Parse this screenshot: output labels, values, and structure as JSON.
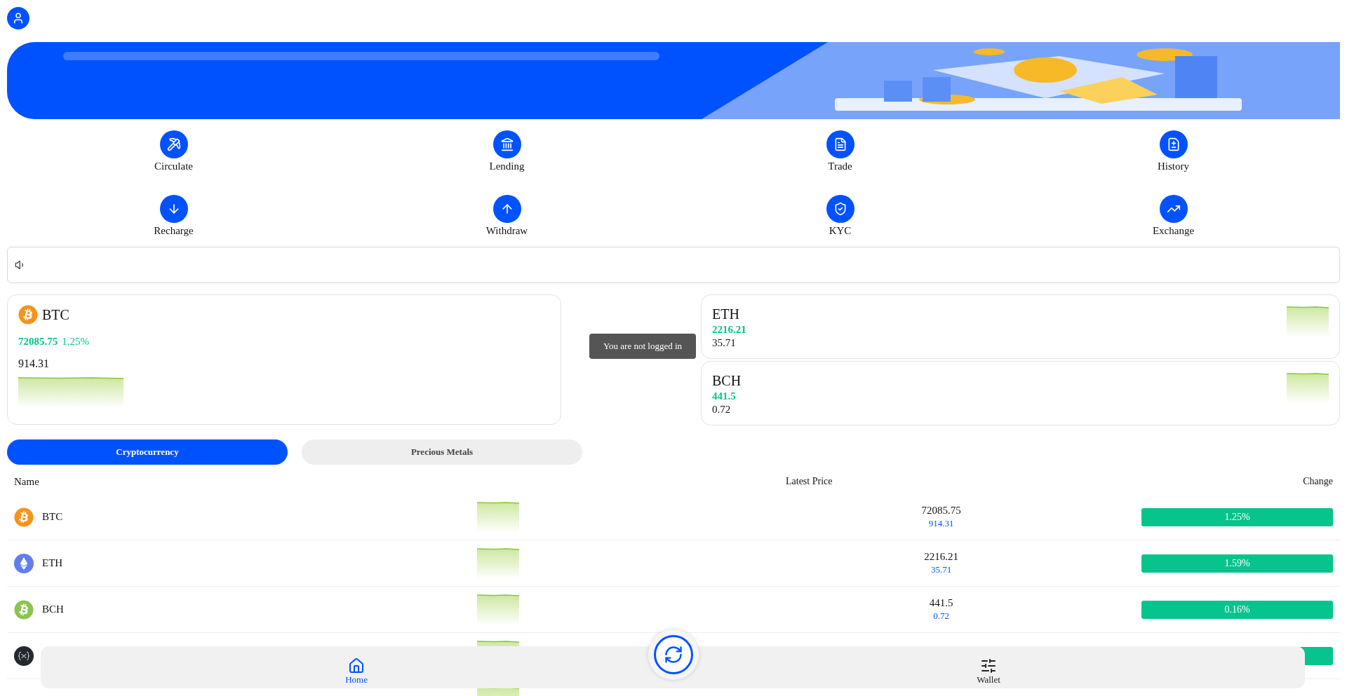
{
  "menu": [
    {
      "label": "Circulate"
    },
    {
      "label": "Lending"
    },
    {
      "label": "Trade"
    },
    {
      "label": "History"
    },
    {
      "label": "Recharge"
    },
    {
      "label": "Withdraw"
    },
    {
      "label": "KYC"
    },
    {
      "label": "Exchange"
    }
  ],
  "featured": {
    "name": "BTC",
    "price": "72085.75",
    "change": "1.25%",
    "amount": "914.31"
  },
  "side_cards": [
    {
      "name": "ETH",
      "price": "2216.21",
      "amount": "35.71"
    },
    {
      "name": "BCH",
      "price": "441.5",
      "amount": "0.72"
    }
  ],
  "tooltip": "You are not logged in",
  "tabs": [
    {
      "label": "Cryptocurrency",
      "selected": true
    },
    {
      "label": "Precious Metals",
      "selected": false
    }
  ],
  "table": {
    "columns": [
      "Name",
      "Latest Price",
      "Change"
    ],
    "rows": [
      {
        "kind": "bitcoin",
        "name": "BTC",
        "price": "72085.75",
        "amount": "914.31",
        "change": "1.25%"
      },
      {
        "kind": "ethereum",
        "name": "ETH",
        "price": "2216.21",
        "amount": "35.71",
        "change": "1.59%"
      },
      {
        "kind": "bitcoincash",
        "name": "BCH",
        "price": "441.5",
        "amount": "0.72",
        "change": "0.16%"
      },
      {
        "kind": "xrp"
      }
    ]
  },
  "bottom_nav": [
    {
      "label": "Home",
      "selected": true
    },
    {
      "label": "Wallet",
      "selected": false
    }
  ]
}
